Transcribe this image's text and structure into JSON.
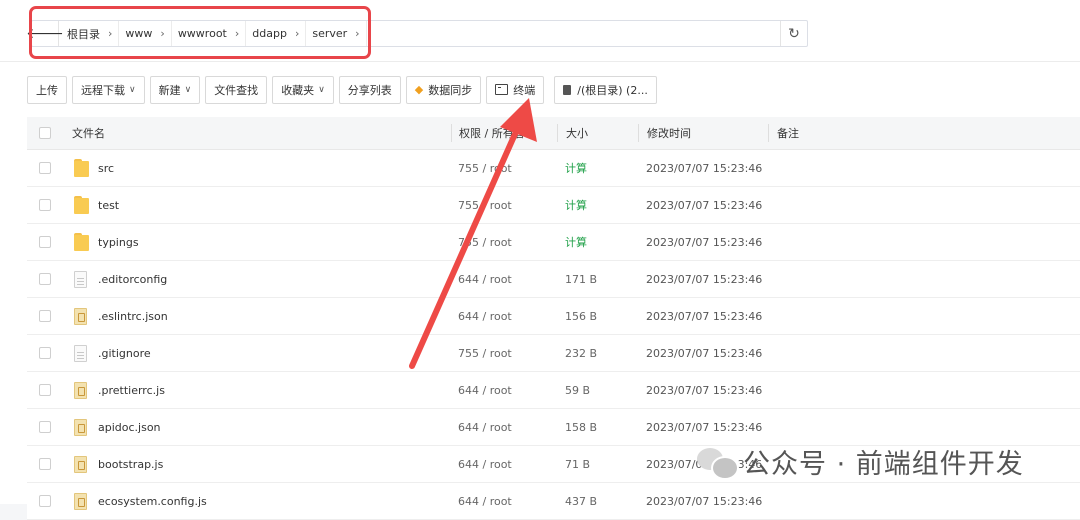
{
  "path": {
    "back_icon": "arrow-left-icon",
    "crumbs": [
      "根目录",
      "www",
      "wwwroot",
      "ddapp",
      "server"
    ],
    "refresh_icon": "refresh-icon"
  },
  "toolbar": {
    "upload": "上传",
    "remote_download": "远程下载",
    "new": "新建",
    "file_search": "文件查找",
    "favorites": "收藏夹",
    "share_list": "分享列表",
    "data_sync": "数据同步",
    "terminal": "终端",
    "disk": "/(根目录) (2..."
  },
  "table": {
    "headers": {
      "name": "文件名",
      "perm": "权限 / 所有者",
      "size": "大小",
      "mtime": "修改时间",
      "note": "备注"
    },
    "rows": [
      {
        "type": "folder",
        "name": "src",
        "perm": "755 / root",
        "size": "计算",
        "mtime": "2023/07/07 15:23:46"
      },
      {
        "type": "folder",
        "name": "test",
        "perm": "755 / root",
        "size": "计算",
        "mtime": "2023/07/07 15:23:46"
      },
      {
        "type": "folder",
        "name": "typings",
        "perm": "755 / root",
        "size": "计算",
        "mtime": "2023/07/07 15:23:46"
      },
      {
        "type": "doc",
        "name": ".editorconfig",
        "perm": "644 / root",
        "size": "171 B",
        "mtime": "2023/07/07 15:23:46"
      },
      {
        "type": "code",
        "name": ".eslintrc.json",
        "perm": "644 / root",
        "size": "156 B",
        "mtime": "2023/07/07 15:23:46"
      },
      {
        "type": "doc",
        "name": ".gitignore",
        "perm": "755 / root",
        "size": "232 B",
        "mtime": "2023/07/07 15:23:46"
      },
      {
        "type": "code",
        "name": ".prettierrc.js",
        "perm": "644 / root",
        "size": "59 B",
        "mtime": "2023/07/07 15:23:46"
      },
      {
        "type": "code",
        "name": "apidoc.json",
        "perm": "644 / root",
        "size": "158 B",
        "mtime": "2023/07/07 15:23:46"
      },
      {
        "type": "code",
        "name": "bootstrap.js",
        "perm": "644 / root",
        "size": "71 B",
        "mtime": "2023/07/07 15:23:46"
      },
      {
        "type": "code",
        "name": "ecosystem.config.js",
        "perm": "644 / root",
        "size": "437 B",
        "mtime": "2023/07/07 15:23:46"
      }
    ]
  },
  "watermark": {
    "text": "公众号 · 前端组件开发"
  },
  "colors": {
    "highlight": "#e8454a",
    "arrow": "#ee4a46",
    "calc": "#22a14a"
  }
}
